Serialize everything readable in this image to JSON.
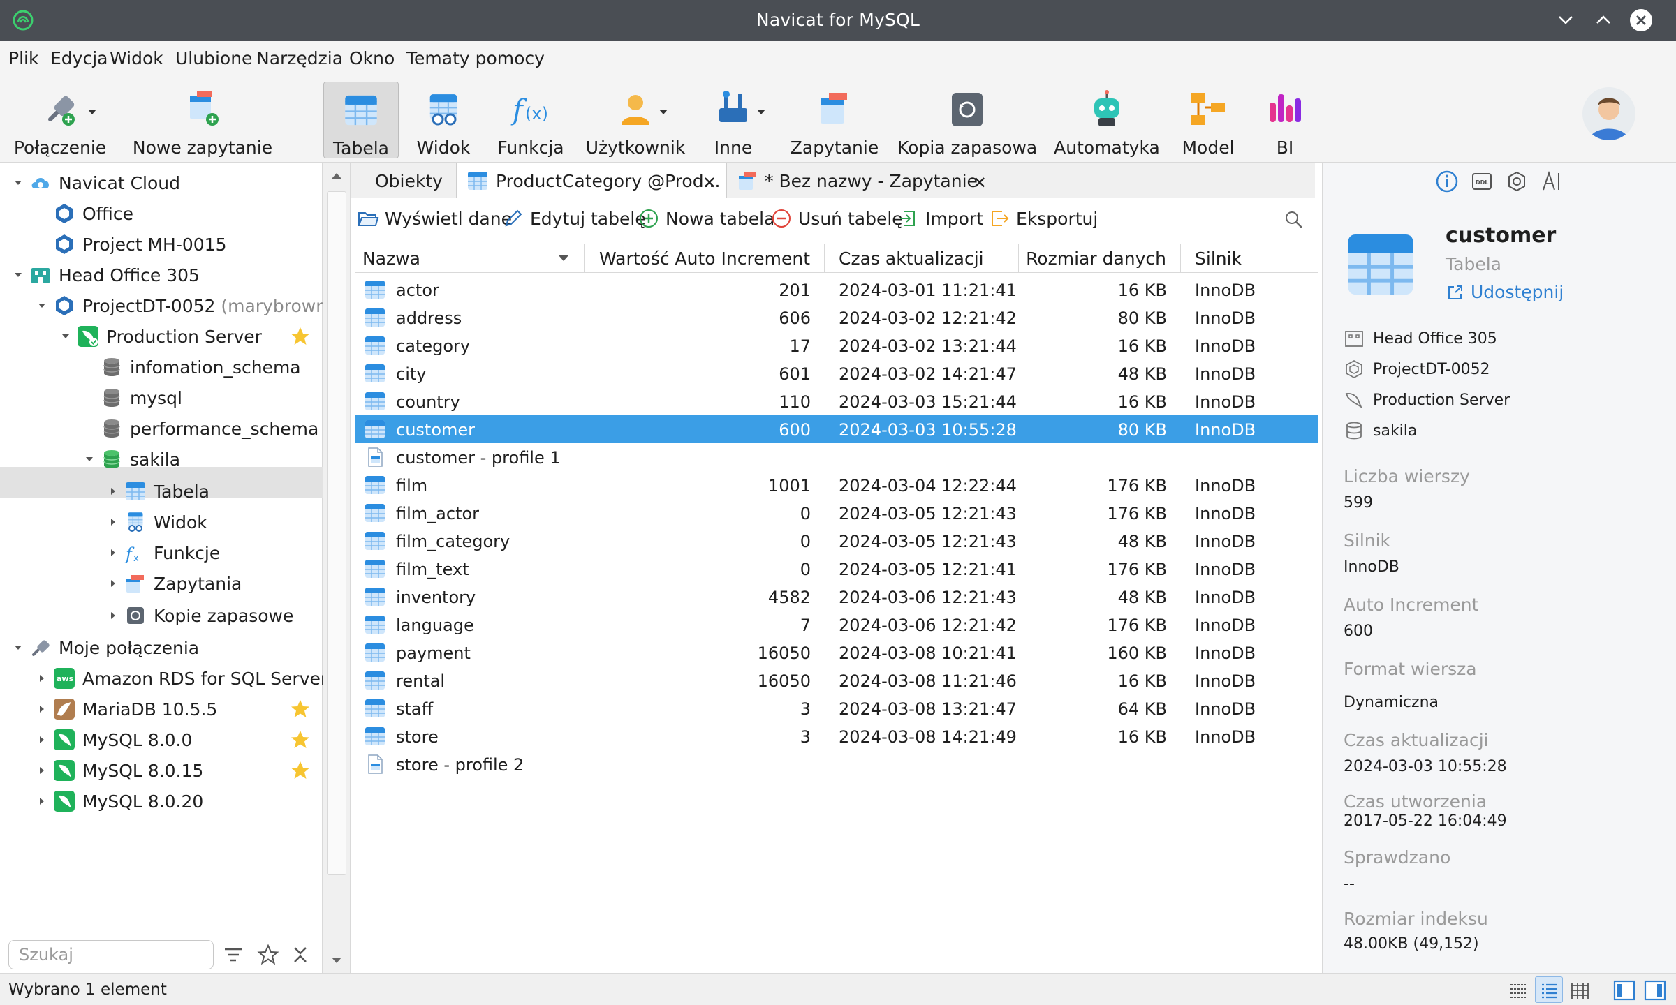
{
  "window": {
    "title": "Navicat for MySQL"
  },
  "menu": [
    "Plik",
    "Edycja",
    "Widok",
    "Ulubione",
    "Narzędzia",
    "Okno",
    "Tematy pomocy"
  ],
  "toolbar": {
    "items": [
      "Połączenie",
      "Nowe zapytanie",
      "Tabela",
      "Widok",
      "Funkcja",
      "Użytkownik",
      "Inne",
      "Zapytanie",
      "Kopia zapasowa",
      "Automatyka",
      "Model",
      "BI"
    ],
    "active": "Tabela"
  },
  "tree": {
    "navicat_cloud": "Navicat Cloud",
    "office": "Office",
    "project_mh": "Project MH-0015",
    "head_office": "Head Office 305",
    "project_dt": "ProjectDT-0052",
    "project_dt_owner": "(marybrown)",
    "production_server": "Production Server",
    "dbs": [
      "infomation_schema",
      "mysql",
      "performance_schema",
      "sakila"
    ],
    "sakila_children": [
      "Tabela",
      "Widok",
      "Funkcje",
      "Zapytania",
      "Kopie zapasowe"
    ],
    "my_connections": "Moje połączenia",
    "connections": [
      "Amazon RDS for SQL Server",
      "MariaDB 10.5.5",
      "MySQL 8.0.0",
      "MySQL 8.0.15",
      "MySQL 8.0.20"
    ]
  },
  "search": {
    "placeholder": "Szukaj"
  },
  "tabs": [
    "Obiekty",
    "ProductCategory @Prod...",
    "* Bez nazwy - Zapytanie"
  ],
  "object_toolbar": [
    "Wyświetl dane",
    "Edytuj tabelę",
    "Nowa tabela",
    "Usuń tabelę",
    "Import",
    "Eksportuj"
  ],
  "columns": [
    "Nazwa",
    "Wartość Auto Increment",
    "Czas aktualizacji",
    "Rozmiar danych",
    "Silnik"
  ],
  "rows": [
    {
      "name": "actor",
      "ai": "201",
      "time": "2024-03-01 11:21:41",
      "size": "16 KB",
      "engine": "InnoDB",
      "type": "table"
    },
    {
      "name": "address",
      "ai": "606",
      "time": "2024-03-02 12:21:42",
      "size": "80 KB",
      "engine": "InnoDB",
      "type": "table"
    },
    {
      "name": "category",
      "ai": "17",
      "time": "2024-03-02 13:21:44",
      "size": "16 KB",
      "engine": "InnoDB",
      "type": "table"
    },
    {
      "name": "city",
      "ai": "601",
      "time": "2024-03-02 14:21:47",
      "size": "48 KB",
      "engine": "InnoDB",
      "type": "table"
    },
    {
      "name": "country",
      "ai": "110",
      "time": "2024-03-03 15:21:44",
      "size": "16 KB",
      "engine": "InnoDB",
      "type": "table"
    },
    {
      "name": "customer",
      "ai": "600",
      "time": "2024-03-03 10:55:28",
      "size": "80 KB",
      "engine": "InnoDB",
      "type": "table",
      "selected": true
    },
    {
      "name": "customer - profile 1",
      "ai": "",
      "time": "",
      "size": "",
      "engine": "",
      "type": "profile"
    },
    {
      "name": "film",
      "ai": "1001",
      "time": "2024-03-04 12:22:44",
      "size": "176 KB",
      "engine": "InnoDB",
      "type": "table"
    },
    {
      "name": "film_actor",
      "ai": "0",
      "time": "2024-03-05 12:21:43",
      "size": "176 KB",
      "engine": "InnoDB",
      "type": "table"
    },
    {
      "name": "film_category",
      "ai": "0",
      "time": "2024-03-05 12:21:43",
      "size": "48 KB",
      "engine": "InnoDB",
      "type": "table"
    },
    {
      "name": "film_text",
      "ai": "0",
      "time": "2024-03-05 12:21:41",
      "size": "176 KB",
      "engine": "InnoDB",
      "type": "table"
    },
    {
      "name": "inventory",
      "ai": "4582",
      "time": "2024-03-06 12:21:43",
      "size": "48 KB",
      "engine": "InnoDB",
      "type": "table"
    },
    {
      "name": "language",
      "ai": "7",
      "time": "2024-03-06 12:21:42",
      "size": "176 KB",
      "engine": "InnoDB",
      "type": "table"
    },
    {
      "name": "payment",
      "ai": "16050",
      "time": "2024-03-08 10:21:41",
      "size": "160 KB",
      "engine": "InnoDB",
      "type": "table"
    },
    {
      "name": "rental",
      "ai": "16050",
      "time": "2024-03-08 11:21:46",
      "size": "16 KB",
      "engine": "InnoDB",
      "type": "table"
    },
    {
      "name": "staff",
      "ai": "3",
      "time": "2024-03-08 13:21:47",
      "size": "64 KB",
      "engine": "InnoDB",
      "type": "table"
    },
    {
      "name": "store",
      "ai": "3",
      "time": "2024-03-08 14:21:49",
      "size": "16 KB",
      "engine": "InnoDB",
      "type": "table"
    },
    {
      "name": "store - profile 2",
      "ai": "",
      "time": "",
      "size": "",
      "engine": "",
      "type": "profile"
    }
  ],
  "info": {
    "name": "customer",
    "kind": "Tabela",
    "share": "Udostępnij",
    "path": [
      "Head Office 305",
      "ProjectDT-0052",
      "Production Server",
      "sakila"
    ],
    "fields": [
      {
        "label": "Liczba wierszy",
        "value": "599"
      },
      {
        "label": "Silnik",
        "value": "InnoDB"
      },
      {
        "label": "Auto Increment",
        "value": "600"
      },
      {
        "label": "Format wiersza",
        "value": "Dynamiczna"
      },
      {
        "label": "Czas aktualizacji",
        "value": "2024-03-03 10:55:28"
      },
      {
        "label": "Czas utworzenia",
        "value": "2017-05-22 16:04:49"
      },
      {
        "label": "Sprawdzano",
        "value": "--"
      },
      {
        "label": "Rozmiar indeksu",
        "value": "48.00KB (49,152)"
      }
    ]
  },
  "status": {
    "text": "Wybrano 1 element"
  },
  "colors": {
    "accent": "#3b9ee6",
    "titlebar": "#4a4e54",
    "link": "#2f80d1"
  }
}
